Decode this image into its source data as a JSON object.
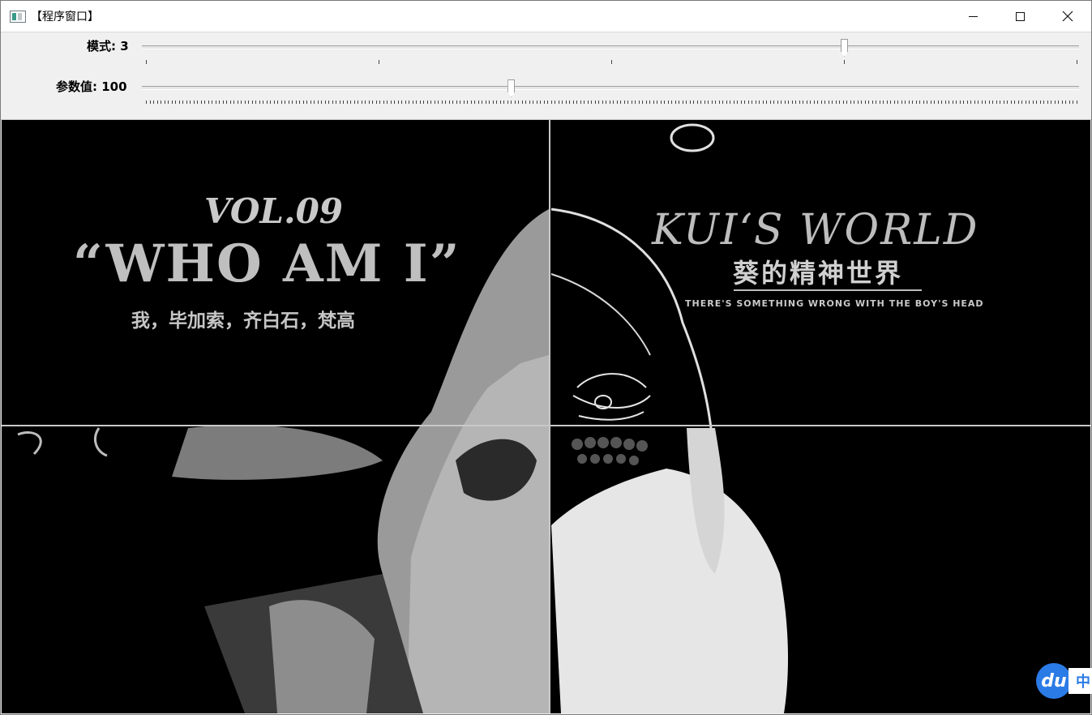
{
  "window": {
    "title": "【程序窗口】"
  },
  "toolbar": {
    "mode": {
      "label": "模式: 3",
      "value": 3,
      "max": 4
    },
    "param": {
      "label": "参数值: 100",
      "value": 100,
      "max": 255
    }
  },
  "image": {
    "vol": "VOL.09",
    "headline": "“WHO AM I”",
    "subline": "我，毕加索，齐白石，梵高",
    "kui_title": "KUI‘S WORLD",
    "kui_cn": "葵的精神世界",
    "kui_tag": "THERE'S SOMETHING WRONG WITH THE BOY'S HEAD"
  },
  "ime_badge": {
    "logo": "du",
    "text": "中"
  },
  "colors": {
    "ime_blue": "#2b7be6"
  }
}
